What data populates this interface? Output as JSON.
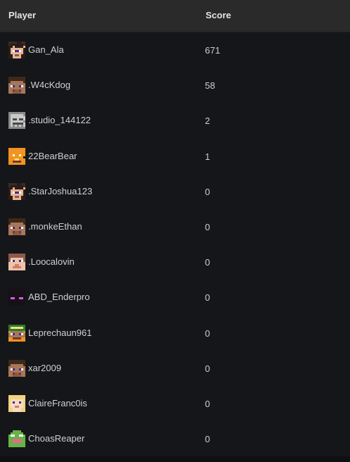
{
  "header": {
    "player_label": "Player",
    "score_label": "Score"
  },
  "rows": [
    {
      "player": "Gan_Ala",
      "score": "671",
      "avatar": "dark-hair-icon"
    },
    {
      "player": ".W4cKdog",
      "score": "58",
      "avatar": "steve-icon"
    },
    {
      "player": ".studio_144122",
      "score": "2",
      "avatar": "skeleton-icon"
    },
    {
      "player": "22BearBear",
      "score": "1",
      "avatar": "orange-bear-icon"
    },
    {
      "player": ".StarJoshua123",
      "score": "0",
      "avatar": "dark-hair-icon"
    },
    {
      "player": ".monkeEthan",
      "score": "0",
      "avatar": "steve-icon"
    },
    {
      "player": ".Loocalovin",
      "score": "0",
      "avatar": "bald-face-icon"
    },
    {
      "player": "ABD_Enderpro",
      "score": "0",
      "avatar": "enderman-icon"
    },
    {
      "player": "Leprechaun961",
      "score": "0",
      "avatar": "leprechaun-icon"
    },
    {
      "player": "xar2009",
      "score": "0",
      "avatar": "steve-icon"
    },
    {
      "player": "ClaireFranc0is",
      "score": "0",
      "avatar": "blonde-face-icon"
    },
    {
      "player": "ChoasReaper",
      "score": "0",
      "avatar": "green-creature-icon"
    }
  ]
}
